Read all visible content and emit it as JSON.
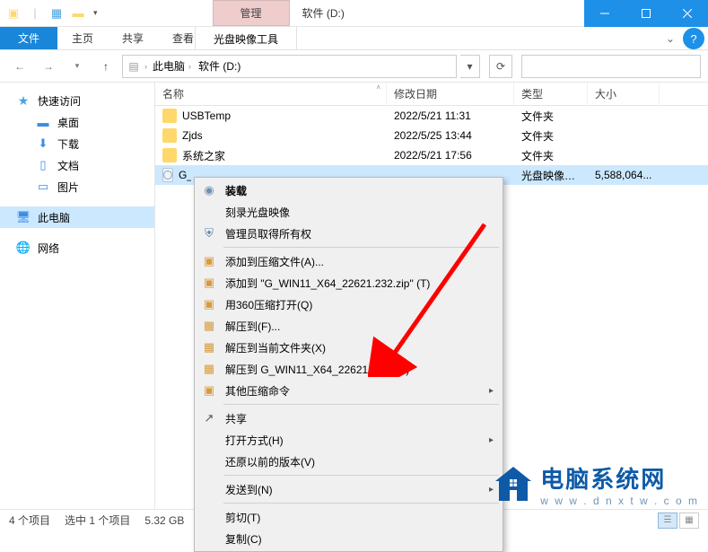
{
  "titlebar": {
    "context_tab": "管理",
    "title": "软件 (D:)"
  },
  "ribbon": {
    "file": "文件",
    "home": "主页",
    "share": "共享",
    "view": "查看",
    "tool": "光盘映像工具"
  },
  "breadcrumb": {
    "root": "此电脑",
    "current": "软件 (D:)"
  },
  "search": {
    "placeholder": ""
  },
  "sidebar": {
    "quick_access": "快速访问",
    "desktop": "桌面",
    "downloads": "下载",
    "documents": "文档",
    "pictures": "图片",
    "this_pc": "此电脑",
    "network": "网络"
  },
  "columns": {
    "name": "名称",
    "date": "修改日期",
    "type": "类型",
    "size": "大小"
  },
  "files": [
    {
      "name": "USBTemp",
      "date": "2022/5/21 11:31",
      "type": "文件夹",
      "size": "",
      "kind": "folder"
    },
    {
      "name": "Zjds",
      "date": "2022/5/25 13:44",
      "type": "文件夹",
      "size": "",
      "kind": "folder"
    },
    {
      "name": "系统之家",
      "date": "2022/5/21 17:56",
      "type": "文件夹",
      "size": "",
      "kind": "folder"
    },
    {
      "name": "G_",
      "date": "",
      "type": "光盘映像文件",
      "size": "5,588,064...",
      "kind": "iso",
      "selected": true
    }
  ],
  "context_menu": {
    "mount": "装载",
    "burn": "刻录光盘映像",
    "admin": "管理员取得所有权",
    "add_to_archive": "添加到压缩文件(A)...",
    "add_to_zip": "添加到 \"G_WIN11_X64_22621.232.zip\" (T)",
    "open_360": "用360压缩打开(Q)",
    "extract_to": "解压到(F)...",
    "extract_here": "解压到当前文件夹(X)",
    "extract_named": "解压到 G_WIN11_X64_22621.232\\ (E)",
    "other_zip": "其他压缩命令",
    "share": "共享",
    "open_with": "打开方式(H)",
    "restore_prev": "还原以前的版本(V)",
    "send_to": "发送到(N)",
    "cut": "剪切(T)",
    "copy": "复制(C)"
  },
  "statusbar": {
    "count": "4 个项目",
    "selection": "选中 1 个项目",
    "size": "5.32 GB"
  },
  "watermark": {
    "title": "电脑系统网",
    "sub": "w w w . d n x t w . c o m"
  }
}
